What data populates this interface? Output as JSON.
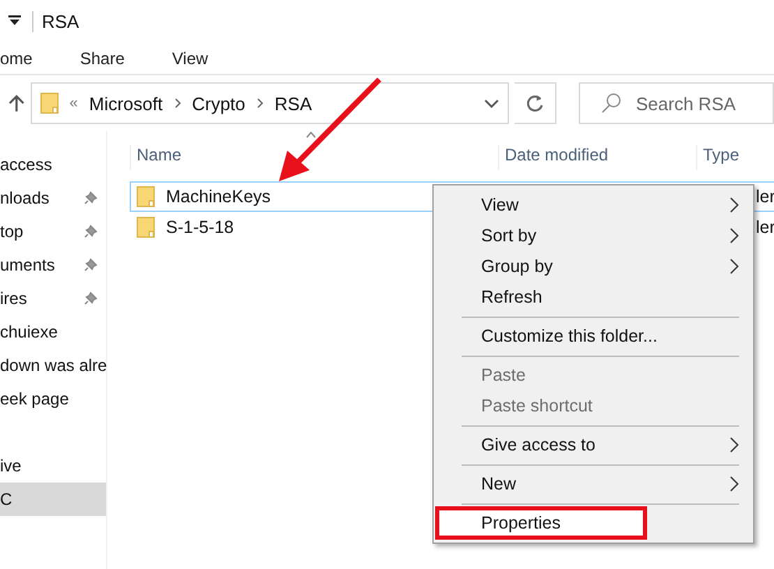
{
  "window": {
    "title": "RSA"
  },
  "ribbon_tabs": [
    "ome",
    "Share",
    "View"
  ],
  "address": {
    "overflow": "«",
    "crumbs": [
      "Microsoft",
      "Crypto",
      "RSA"
    ]
  },
  "search": {
    "placeholder": "Search RSA"
  },
  "columns": [
    "Name",
    "Date modified",
    "Type"
  ],
  "sidebar": {
    "sections": [
      [
        {
          "label": "access",
          "pinned": false,
          "selected": false
        },
        {
          "label": "nloads",
          "pinned": true,
          "selected": false
        },
        {
          "label": "top",
          "pinned": true,
          "selected": false
        },
        {
          "label": "uments",
          "pinned": true,
          "selected": false
        },
        {
          "label": "ires",
          "pinned": true,
          "selected": false
        },
        {
          "label": "chuiexe",
          "pinned": false,
          "selected": false
        },
        {
          "label": "down was alre",
          "pinned": false,
          "selected": false
        },
        {
          "label": "eek page",
          "pinned": false,
          "selected": false
        }
      ],
      [
        {
          "label": "ive",
          "pinned": false,
          "selected": false
        },
        {
          "label": "C",
          "pinned": false,
          "selected": true
        }
      ]
    ]
  },
  "files": [
    {
      "name": "MachineKeys",
      "type": "ler",
      "selected": true
    },
    {
      "name": "S-1-5-18",
      "type": "ler",
      "selected": false
    }
  ],
  "context_menu": {
    "groups": [
      [
        {
          "label": "View",
          "submenu": true,
          "disabled": false,
          "selected": false,
          "annotated": false
        },
        {
          "label": "Sort by",
          "submenu": true,
          "disabled": false,
          "selected": false,
          "annotated": false
        },
        {
          "label": "Group by",
          "submenu": true,
          "disabled": false,
          "selected": false,
          "annotated": false
        },
        {
          "label": "Refresh",
          "submenu": false,
          "disabled": false,
          "selected": false,
          "annotated": false
        }
      ],
      [
        {
          "label": "Customize this folder...",
          "submenu": false,
          "disabled": false,
          "selected": false,
          "annotated": false
        }
      ],
      [
        {
          "label": "Paste",
          "submenu": false,
          "disabled": true,
          "selected": false,
          "annotated": false
        },
        {
          "label": "Paste shortcut",
          "submenu": false,
          "disabled": true,
          "selected": false,
          "annotated": false
        }
      ],
      [
        {
          "label": "Give access to",
          "submenu": true,
          "disabled": false,
          "selected": false,
          "annotated": false
        }
      ],
      [
        {
          "label": "New",
          "submenu": true,
          "disabled": false,
          "selected": false,
          "annotated": false
        }
      ],
      [
        {
          "label": "Properties",
          "submenu": false,
          "disabled": false,
          "selected": true,
          "annotated": true
        }
      ]
    ]
  }
}
